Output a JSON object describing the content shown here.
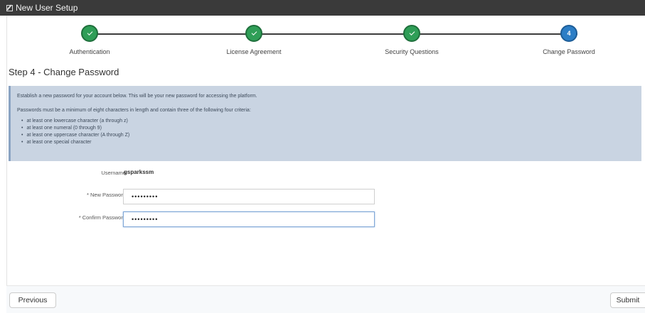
{
  "window": {
    "title": "New User Setup"
  },
  "wizard": {
    "steps": [
      {
        "label": "Authentication",
        "state": "complete"
      },
      {
        "label": "License Agreement",
        "state": "complete"
      },
      {
        "label": "Security Questions",
        "state": "complete"
      },
      {
        "label": "Change Password",
        "state": "active",
        "number": "4"
      }
    ]
  },
  "page": {
    "title": "Step 4 - Change Password"
  },
  "info": {
    "intro": "Establish a new password for your account below. This will be your new password for accessing the platform.",
    "rules_intro": "Passwords must be a minimum of eight characters in length and contain three of the following four criteria:",
    "criteria": [
      "at least one lowercase character (a through z)",
      "at least one numeral (0 through 9)",
      "at least one uppercase character (A through Z)",
      "at least one special character"
    ]
  },
  "form": {
    "username_label": "Username",
    "username_value": "gsparkssm",
    "new_password_label": "* New Password",
    "new_password_value": "•••••••••",
    "confirm_password_label": "* Confirm Password",
    "confirm_password_value": "•••••••••"
  },
  "footer": {
    "previous_label": "Previous",
    "submit_label": "Submit"
  },
  "colors": {
    "complete": "#2f9e57",
    "active": "#2c7ec6",
    "info_bg": "#c9d4e2",
    "titlebar": "#3a3a3a"
  }
}
